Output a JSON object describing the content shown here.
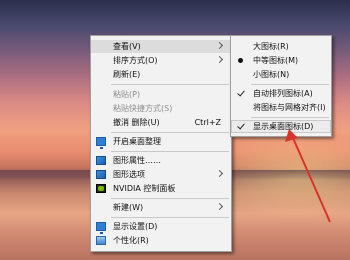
{
  "context_menu": {
    "items": [
      {
        "label": "查看(V)"
      },
      {
        "label": "排序方式(O)"
      },
      {
        "label": "刷新(E)"
      },
      {
        "label": "粘贴(P)"
      },
      {
        "label": "粘贴快捷方式(S)"
      },
      {
        "label": "撤消 删除(U)",
        "shortcut": "Ctrl+Z"
      },
      {
        "label": "开启桌面整理"
      },
      {
        "label": "图形属性……"
      },
      {
        "label": "图形选项"
      },
      {
        "label": "NVIDIA 控制面板"
      },
      {
        "label": "新建(W)"
      },
      {
        "label": "显示设置(D)"
      },
      {
        "label": "个性化(R)"
      }
    ]
  },
  "view_submenu": {
    "items": [
      {
        "label": "大图标(R)"
      },
      {
        "label": "中等图标(M)",
        "state": "radio-selected"
      },
      {
        "label": "小图标(N)"
      },
      {
        "label": "自动排列图标(A)",
        "state": "checked"
      },
      {
        "label": "将图标与网格对齐(I)"
      },
      {
        "label": "显示桌面图标(D)",
        "state": "checked"
      }
    ]
  },
  "colors": {
    "menu_bg": "#f2f2f2",
    "annotation_arrow": "#d8342a"
  }
}
